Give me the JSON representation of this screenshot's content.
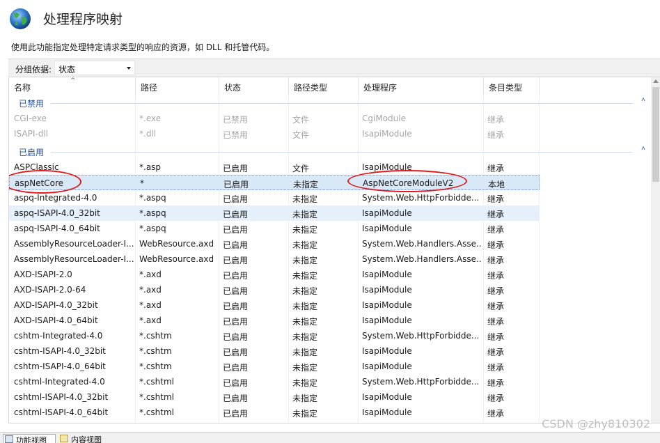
{
  "header": {
    "title": "处理程序映射",
    "description": "使用此功能指定处理特定请求类型的响应的资源，如 DLL 和托管代码。",
    "icon": "globe-icon"
  },
  "group_by": {
    "label": "分组依据:",
    "value": "状态"
  },
  "columns": [
    "名称",
    "路径",
    "状态",
    "路径类型",
    "处理程序",
    "条目类型"
  ],
  "groups": {
    "disabled": {
      "title": "已禁用",
      "rows": [
        [
          "CGI-exe",
          "*.exe",
          "已禁用",
          "文件",
          "CgiModule",
          "继承"
        ],
        [
          "ISAPI-dll",
          "*.dll",
          "已禁用",
          "文件",
          "IsapiModule",
          "继承"
        ]
      ]
    },
    "enabled": {
      "title": "已启用",
      "rows": [
        [
          "ASPClassic",
          "*.asp",
          "已启用",
          "文件",
          "IsapiModule",
          "继承"
        ],
        [
          "aspNetCore",
          "*",
          "已启用",
          "未指定",
          "AspNetCoreModuleV2",
          "本地"
        ],
        [
          "aspq-Integrated-4.0",
          "*.aspq",
          "已启用",
          "未指定",
          "System.Web.HttpForbidde...",
          "继承"
        ],
        [
          "aspq-ISAPI-4.0_32bit",
          "*.aspq",
          "已启用",
          "未指定",
          "IsapiModule",
          "继承"
        ],
        [
          "aspq-ISAPI-4.0_64bit",
          "*.aspq",
          "已启用",
          "未指定",
          "IsapiModule",
          "继承"
        ],
        [
          "AssemblyResourceLoader-I...",
          "WebResource.axd",
          "已启用",
          "未指定",
          "System.Web.Handlers.Asse...",
          "继承"
        ],
        [
          "AssemblyResourceLoader-I...",
          "WebResource.axd",
          "已启用",
          "未指定",
          "System.Web.Handlers.Asse...",
          "继承"
        ],
        [
          "AXD-ISAPI-2.0",
          "*.axd",
          "已启用",
          "未指定",
          "IsapiModule",
          "继承"
        ],
        [
          "AXD-ISAPI-2.0-64",
          "*.axd",
          "已启用",
          "未指定",
          "IsapiModule",
          "继承"
        ],
        [
          "AXD-ISAPI-4.0_32bit",
          "*.axd",
          "已启用",
          "未指定",
          "IsapiModule",
          "继承"
        ],
        [
          "AXD-ISAPI-4.0_64bit",
          "*.axd",
          "已启用",
          "未指定",
          "IsapiModule",
          "继承"
        ],
        [
          "cshtm-Integrated-4.0",
          "*.cshtm",
          "已启用",
          "未指定",
          "System.Web.HttpForbidde...",
          "继承"
        ],
        [
          "cshtm-ISAPI-4.0_32bit",
          "*.cshtm",
          "已启用",
          "未指定",
          "IsapiModule",
          "继承"
        ],
        [
          "cshtm-ISAPI-4.0_64bit",
          "*.cshtm",
          "已启用",
          "未指定",
          "IsapiModule",
          "继承"
        ],
        [
          "cshtml-Integrated-4.0",
          "*.cshtml",
          "已启用",
          "未指定",
          "System.Web.HttpForbidde...",
          "继承"
        ],
        [
          "cshtml-ISAPI-4.0_32bit",
          "*.cshtml",
          "已启用",
          "未指定",
          "IsapiModule",
          "继承"
        ],
        [
          "cshtml-ISAPI-4.0_64bit",
          "*.cshtml",
          "已启用",
          "未指定",
          "IsapiModule",
          "继承"
        ]
      ]
    }
  },
  "bottom_tabs": [
    "功能视图",
    "内容视图"
  ],
  "watermark": "CSDN @zhy810302",
  "colors": {
    "selection": "#d9e8f7",
    "group_title": "#1f4e9e",
    "annotation": "#e0191c"
  }
}
